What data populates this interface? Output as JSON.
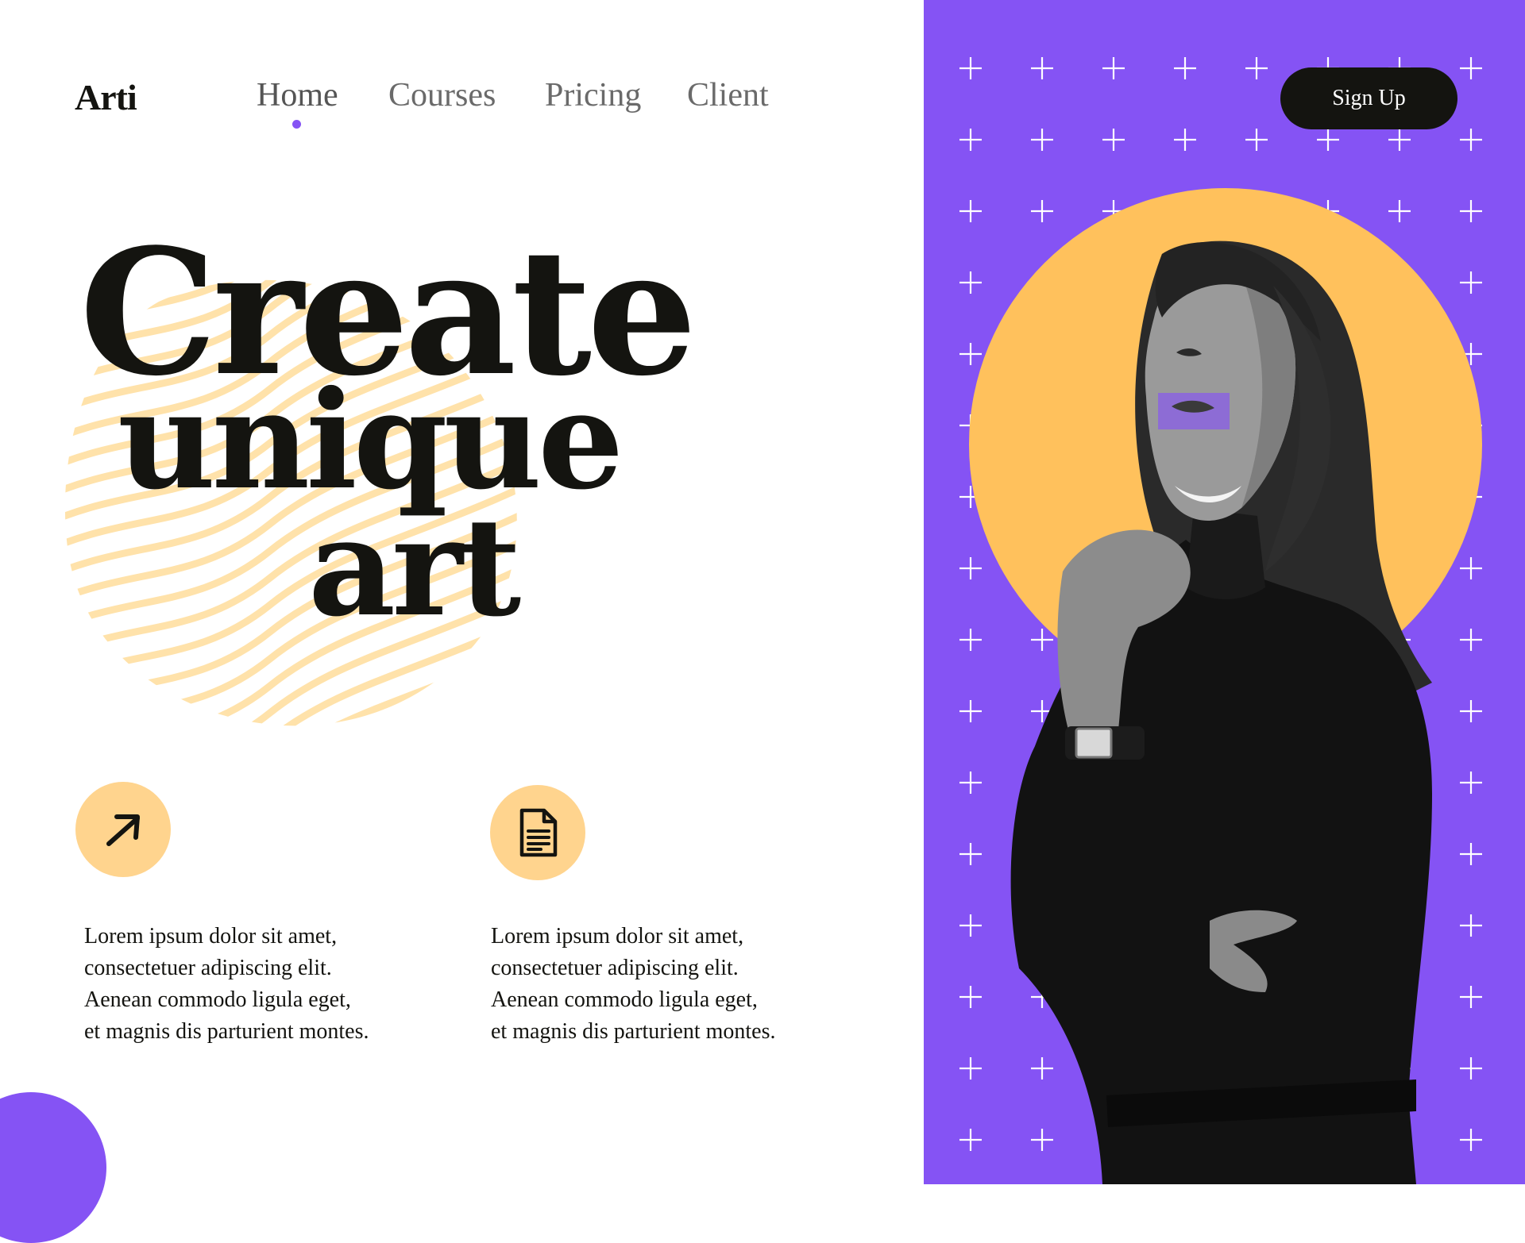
{
  "brand": {
    "logo": "Arti"
  },
  "nav": {
    "items": [
      {
        "label": "Home",
        "active": true
      },
      {
        "label": "Courses",
        "active": false
      },
      {
        "label": "Pricing",
        "active": false
      },
      {
        "label": "Client",
        "active": false
      }
    ],
    "signup_label": "Sign Up"
  },
  "hero": {
    "headline_line1": "Create",
    "headline_line2": "unique",
    "headline_line3": "art"
  },
  "features": [
    {
      "icon": "arrow-up-right-icon",
      "text": "Lorem ipsum dolor sit amet,\nconsectetuer adipiscing elit.\nAenean commodo ligula eget,\net magnis dis parturient montes."
    },
    {
      "icon": "document-icon",
      "text": "Lorem ipsum dolor sit amet,\nconsectetuer adipiscing elit.\nAenean commodo ligula eget,\net magnis dis parturient montes."
    }
  ],
  "colors": {
    "accent_purple": "#8553f4",
    "accent_yellow": "#ffc15c",
    "icon_bg": "#ffd48e",
    "stripe": "#ffe2aa",
    "ink": "#141410"
  },
  "images": {
    "hero_portrait": "black-and-white photo of a smiling woman in a black turtleneck, hand on chin"
  }
}
